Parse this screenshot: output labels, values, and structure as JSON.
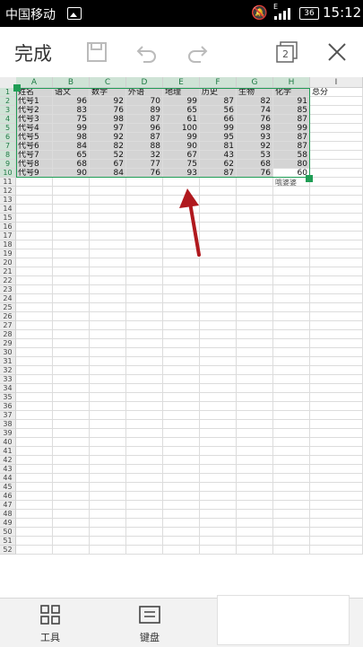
{
  "statusbar": {
    "carrier": "中国移动",
    "network": "E",
    "battery": "36",
    "time": "15:12"
  },
  "toolbar": {
    "done_label": "完成",
    "page_count": "2"
  },
  "sheet": {
    "columns": [
      "A",
      "B",
      "C",
      "D",
      "E",
      "F",
      "G",
      "H",
      "I"
    ],
    "header_row": [
      "姓名",
      "语文",
      "数学",
      "外语",
      "地理",
      "历史",
      "生物",
      "化学",
      "总分"
    ],
    "rows": [
      [
        "代号1",
        "96",
        "92",
        "70",
        "99",
        "87",
        "82",
        "91"
      ],
      [
        "代号2",
        "83",
        "76",
        "89",
        "65",
        "56",
        "74",
        "85"
      ],
      [
        "代号3",
        "75",
        "98",
        "87",
        "61",
        "66",
        "76",
        "87"
      ],
      [
        "代号4",
        "99",
        "97",
        "96",
        "100",
        "99",
        "98",
        "99"
      ],
      [
        "代号5",
        "98",
        "92",
        "87",
        "99",
        "95",
        "93",
        "87"
      ],
      [
        "代号6",
        "84",
        "82",
        "88",
        "90",
        "81",
        "92",
        "87"
      ],
      [
        "代号7",
        "65",
        "52",
        "32",
        "67",
        "43",
        "53",
        "58"
      ],
      [
        "代号8",
        "68",
        "67",
        "77",
        "75",
        "62",
        "68",
        "80"
      ],
      [
        "代号9",
        "90",
        "84",
        "76",
        "93",
        "87",
        "76",
        "60"
      ]
    ],
    "row_count": 52,
    "watermark": "哦婆婆"
  },
  "bottombar": {
    "tools_label": "工具",
    "keyboard_label": "键盘"
  },
  "colors": {
    "selection": "#1f9d55",
    "arrow": "#b0191e",
    "selected_fill": "#d4d4d4"
  }
}
